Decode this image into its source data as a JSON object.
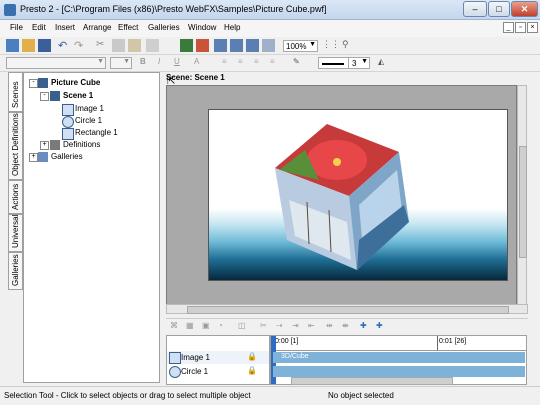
{
  "window": {
    "title": "Presto 2 - [C:\\Program Files (x86)\\Presto WebFX\\Samples\\Picture Cube.pwf]",
    "min_label": "–",
    "max_label": "□",
    "close_label": "✕"
  },
  "menu": [
    "File",
    "Edit",
    "Insert",
    "Arrange",
    "Effect",
    "Galleries",
    "Window",
    "Help"
  ],
  "toolbar": {
    "zoom_value": "100%",
    "line_width_value": "3"
  },
  "left_tabs": [
    "Scenes",
    "Object Definitions",
    "Actions",
    "Universal",
    "Galleries"
  ],
  "tree": {
    "root": "Picture Cube",
    "scene": "Scene 1",
    "image": "Image 1",
    "circle": "Circle 1",
    "rectangle": "Rectangle 1",
    "definitions": "Definitions",
    "galleries": "Galleries"
  },
  "tools": {
    "text_tool": "a",
    "text_box_tool": "a"
  },
  "scene_header": "Scene: Scene 1",
  "timeline": {
    "time_start": "0:00 [1]",
    "time_end": "0:01 [26]",
    "track_image": "Image 1",
    "track_circle": "Circle 1",
    "bar_label": "3D/Cube"
  },
  "status": {
    "hint": "Selection Tool - Click to select objects or drag to select multiple object",
    "selection": "No object selected"
  },
  "colors": {
    "accent": "#3a6fb0",
    "track": "#7fb2d8",
    "stage_sea": "#1f6d94"
  }
}
